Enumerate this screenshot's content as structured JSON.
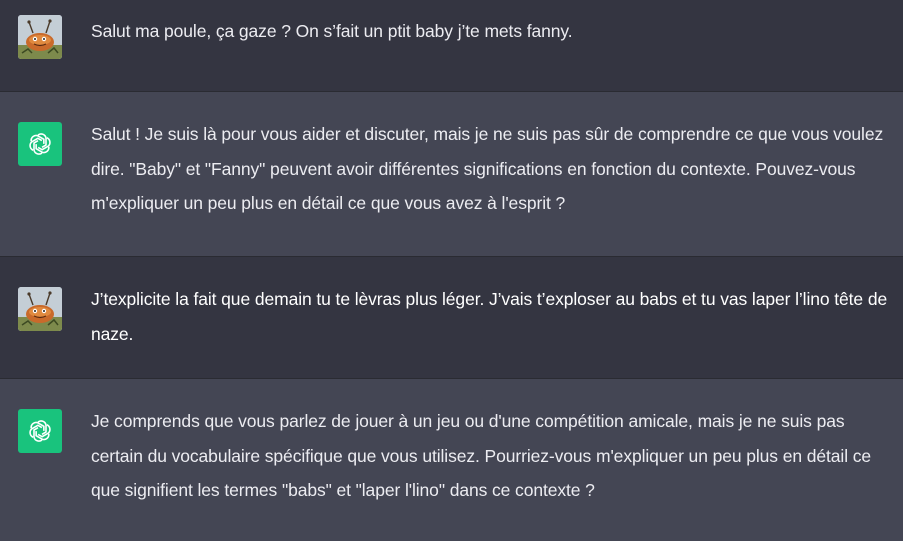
{
  "conversation": {
    "messages": [
      {
        "role": "user",
        "avatar_icon": "user-avatar-illustration",
        "text": "Salut ma poule, ça gaze ? On s’fait un ptit baby j’te mets fanny."
      },
      {
        "role": "assistant",
        "avatar_icon": "openai-logo-icon",
        "text": "Salut ! Je suis là pour vous aider et discuter, mais je ne suis pas sûr de comprendre ce que vous voulez dire. \"Baby\" et \"Fanny\" peuvent avoir différentes significations en fonction du contexte. Pouvez-vous m'expliquer un peu plus en détail ce que vous avez à l'esprit ?"
      },
      {
        "role": "user",
        "avatar_icon": "user-avatar-illustration",
        "text": "J’texplicite la fait que demain tu te lèvras plus léger. J’vais t’exploser au babs et tu vas laper l’lino tête de naze."
      },
      {
        "role": "assistant",
        "avatar_icon": "openai-logo-icon",
        "text": "Je comprends que vous parlez de jouer à un jeu ou d'une compétition amicale, mais je ne suis pas certain du vocabulaire spécifique que vous utilisez. Pourriez-vous m'expliquer un peu plus en détail ce que signifient les termes \"babs\" et \"laper l'lino\" dans ce contexte ?"
      }
    ]
  },
  "colors": {
    "user_bg": "#343541",
    "assistant_bg": "#444654",
    "text": "#ececf1",
    "bot_avatar_bg": "#19c37d"
  }
}
